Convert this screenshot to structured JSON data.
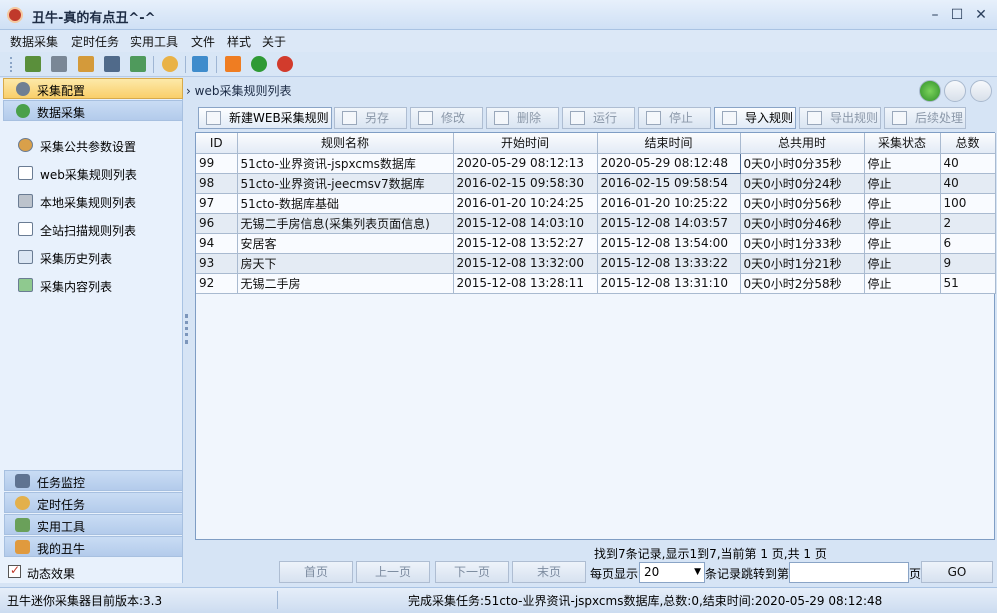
{
  "window": {
    "title": "丑牛-真的有点丑^-^",
    "minimize": "–",
    "maximize": "☐",
    "close": "✕"
  },
  "menu": [
    "数据采集",
    "定时任务",
    "实用工具",
    "文件",
    "样式",
    "关于"
  ],
  "sidebar": {
    "top_sections": [
      {
        "label": "采集配置",
        "icon": "gear-icon",
        "active": true
      },
      {
        "label": "数据采集",
        "icon": "globe-icon",
        "active": false
      }
    ],
    "items": [
      {
        "label": "采集公共参数设置",
        "icon": "settings-icon"
      },
      {
        "label": "web采集规则列表",
        "icon": "list-icon"
      },
      {
        "label": "本地采集规则列表",
        "icon": "drive-icon"
      },
      {
        "label": "全站扫描规则列表",
        "icon": "scan-icon"
      },
      {
        "label": "采集历史列表",
        "icon": "window-icon"
      },
      {
        "label": "采集内容列表",
        "icon": "content-icon"
      }
    ],
    "bottom_sections": [
      {
        "label": "任务监控",
        "icon": "monitor-icon"
      },
      {
        "label": "定时任务",
        "icon": "clock-icon"
      },
      {
        "label": "实用工具",
        "icon": "tool-icon"
      },
      {
        "label": "我的丑牛",
        "icon": "home-icon"
      }
    ],
    "effect_label": "动态效果",
    "effect_checked": true
  },
  "breadcrumb": "web采集规则列表",
  "actions": [
    {
      "label": "新建WEB采集规则",
      "enabled": true
    },
    {
      "label": "另存",
      "enabled": false
    },
    {
      "label": "修改",
      "enabled": false
    },
    {
      "label": "删除",
      "enabled": false
    },
    {
      "label": "运行",
      "enabled": false
    },
    {
      "label": "停止",
      "enabled": false
    },
    {
      "label": "导入规则",
      "enabled": true
    },
    {
      "label": "导出规则",
      "enabled": false
    },
    {
      "label": "后续处理",
      "enabled": false
    }
  ],
  "table": {
    "columns": [
      "ID",
      "规则名称",
      "开始时间",
      "结束时间",
      "总共用时",
      "采集状态",
      "总数"
    ],
    "rows": [
      [
        "99",
        "51cto-业界资讯-jspxcms数据库",
        "2020-05-29 08:12:13",
        "2020-05-29 08:12:48",
        "0天0小时0分35秒",
        "停止",
        "40"
      ],
      [
        "98",
        "51cto-业界资讯-jeecmsv7数据库",
        "2016-02-15 09:58:30",
        "2016-02-15 09:58:54",
        "0天0小时0分24秒",
        "停止",
        "40"
      ],
      [
        "97",
        "51cto-数据库基础",
        "2016-01-20 10:24:25",
        "2016-01-20 10:25:22",
        "0天0小时0分56秒",
        "停止",
        "100"
      ],
      [
        "96",
        "无锡二手房信息(采集列表页面信息)",
        "2015-12-08 14:03:10",
        "2015-12-08 14:03:57",
        "0天0小时0分46秒",
        "停止",
        "2"
      ],
      [
        "94",
        "安居客",
        "2015-12-08 13:52:27",
        "2015-12-08 13:54:00",
        "0天0小时1分33秒",
        "停止",
        "6"
      ],
      [
        "93",
        "房天下",
        "2015-12-08 13:32:00",
        "2015-12-08 13:33:22",
        "0天0小时1分21秒",
        "停止",
        "9"
      ],
      [
        "92",
        "无锡二手房",
        "2015-12-08 13:28:11",
        "2015-12-08 13:31:10",
        "0天0小时2分58秒",
        "停止",
        "51"
      ]
    ]
  },
  "pager": {
    "info": "找到7条记录,显示1到7,当前第 1 页,共 1 页",
    "first": "首页",
    "prev": "上一页",
    "next": "下一页",
    "last": "末页",
    "per_page_label": "每页显示",
    "per_page_value": "20",
    "jump_label": "条记录跳转到第",
    "page_suffix": "页",
    "go": "GO"
  },
  "status": {
    "version": "丑牛迷你采集器目前版本:3.3",
    "message": "完成采集任务:51cto-业界资讯-jspxcms数据库,总数:0,结束时间:2020-05-29 08:12:48"
  },
  "colors": {
    "accent": "#f9cf6a",
    "panel": "#e8f1fc",
    "grid_border": "#7f9dc4"
  }
}
